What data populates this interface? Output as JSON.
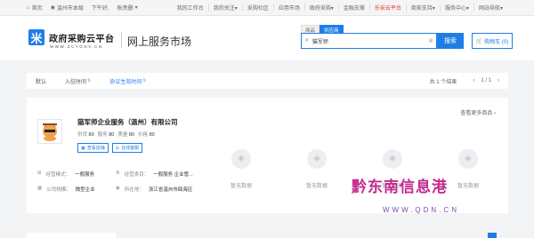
{
  "topbar": {
    "home": "首页",
    "region": "温州市本级",
    "greeting": "下午好,",
    "login": "帐亮删",
    "links": [
      "我的工作台",
      "我的关注",
      "采购社区",
      "应用市场",
      "政府采购",
      "金融支撑",
      "乐采云平台",
      "商家支持",
      "服务中心",
      "网站导航"
    ]
  },
  "header": {
    "logo_char": "米",
    "brand": "政府采购云平台",
    "brand_url": "WWW.ZCYGOV.CN",
    "market": "网上服务市场"
  },
  "search": {
    "tabs": [
      "商品",
      "供应商"
    ],
    "value": "猫军师",
    "button": "搜索",
    "cart": "购物车 (0)"
  },
  "sortbar": {
    "items": [
      "默认",
      "入驻时间",
      "协议生效时间"
    ],
    "result": "共 1 个结果",
    "page": "1 / 1"
  },
  "card": {
    "company": "猫军师企业服务（温州）有限公司",
    "scores": [
      {
        "label": "供货",
        "value": "80"
      },
      {
        "label": "服务",
        "value": "80"
      },
      {
        "label": "质量",
        "value": "80"
      },
      {
        "label": "价格",
        "value": "80"
      }
    ],
    "btn_store": "查看店铺",
    "btn_chat": "在线客服",
    "more": "查看更多商品",
    "info": {
      "mode_label": "经营模式：",
      "mode_value": "一般服务",
      "category_label": "经营类目：",
      "category_value": "一般服务 企业管...",
      "scale_label": "公司规模：",
      "scale_value": "微型企业",
      "location_label": "所在地：",
      "location_value": "浙江省温州市瓯海区"
    },
    "placeholders": [
      "暂无数据",
      "暂无数据",
      "暂无数据",
      "暂无数据"
    ]
  },
  "watermark": {
    "text": "黔东南信息港",
    "url": "WWW.QDN.CN"
  }
}
